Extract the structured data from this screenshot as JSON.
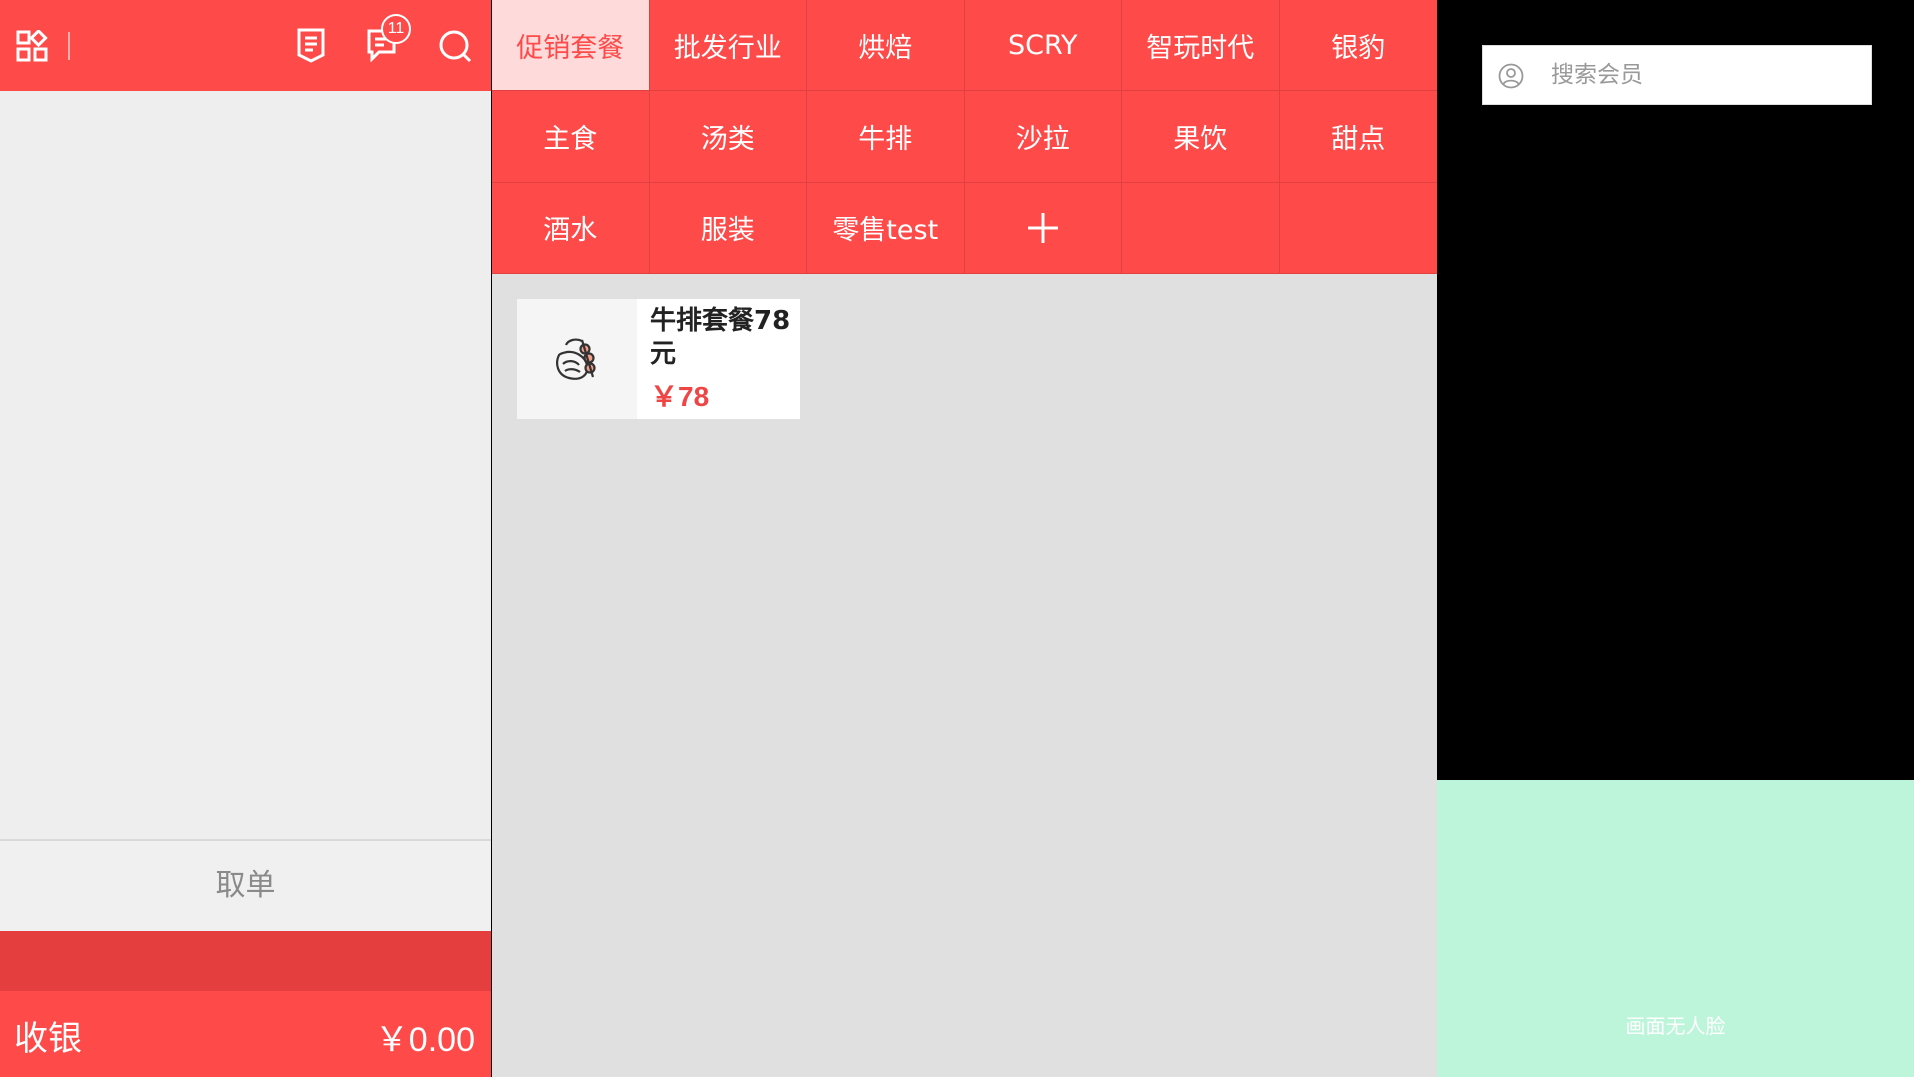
{
  "header": {
    "notification_count": "11"
  },
  "icons": {
    "menu": "apps-grid-icon",
    "orders": "receipt-icon",
    "messages": "message-icon",
    "search": "search-icon",
    "add_category": "plus-icon",
    "member": "user-icon",
    "product": "steak-food-icon"
  },
  "order_panel": {
    "cancel_label": "取单",
    "checkout_label": "收银",
    "checkout_amount": "￥0.00"
  },
  "categories": [
    {
      "label": "促销套餐",
      "active": true
    },
    {
      "label": "批发行业"
    },
    {
      "label": "烘焙"
    },
    {
      "label": "SCRY"
    },
    {
      "label": "智玩时代"
    },
    {
      "label": "银豹"
    },
    {
      "label": "主食"
    },
    {
      "label": "汤类"
    },
    {
      "label": "牛排"
    },
    {
      "label": "沙拉"
    },
    {
      "label": "果饮"
    },
    {
      "label": "甜点"
    },
    {
      "label": "酒水"
    },
    {
      "label": "服装"
    },
    {
      "label": "零售test"
    }
  ],
  "products": [
    {
      "name": "牛排套餐78元",
      "price": "￥78"
    }
  ],
  "member": {
    "search_placeholder": "搜索会员"
  },
  "face": {
    "status": "画面无人脸"
  },
  "colors": {
    "primary_red": "#ff4a4a",
    "active_tab_bg": "#ffdada",
    "price_red": "#f04545",
    "face_bg": "#bdf5da"
  }
}
